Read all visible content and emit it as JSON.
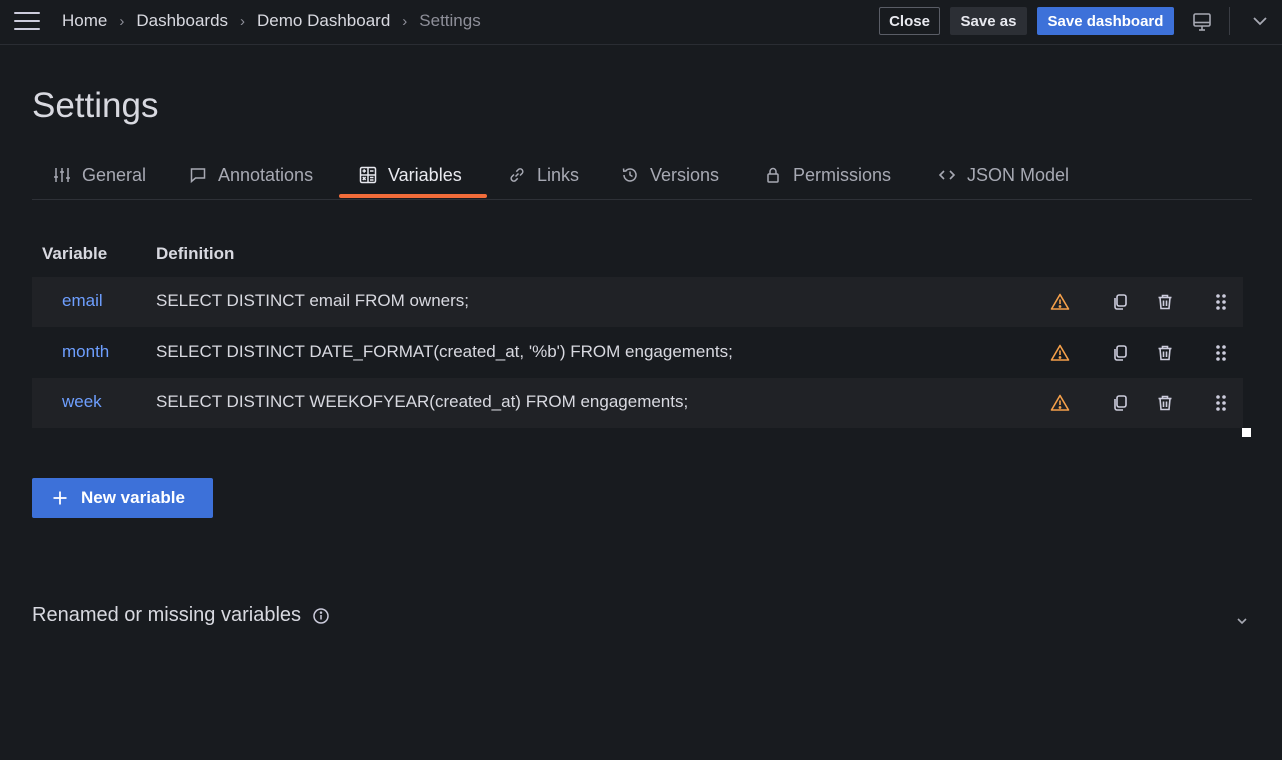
{
  "breadcrumb": {
    "items": [
      "Home",
      "Dashboards",
      "Demo Dashboard",
      "Settings"
    ]
  },
  "toolbar": {
    "close_label": "Close",
    "save_as_label": "Save as",
    "save_dashboard_label": "Save dashboard"
  },
  "page": {
    "title": "Settings"
  },
  "tabs": [
    {
      "label": "General",
      "icon": "sliders-icon"
    },
    {
      "label": "Annotations",
      "icon": "comment-icon"
    },
    {
      "label": "Variables",
      "icon": "calculator-icon",
      "active": true
    },
    {
      "label": "Links",
      "icon": "link-icon"
    },
    {
      "label": "Versions",
      "icon": "history-icon"
    },
    {
      "label": "Permissions",
      "icon": "lock-icon"
    },
    {
      "label": "JSON Model",
      "icon": "code-icon"
    }
  ],
  "table": {
    "headers": {
      "variable": "Variable",
      "definition": "Definition"
    },
    "rows": [
      {
        "name": "email",
        "definition": "SELECT DISTINCT email FROM owners;"
      },
      {
        "name": "month",
        "definition": "SELECT DISTINCT DATE_FORMAT(created_at, '%b') FROM engagements;"
      },
      {
        "name": "week",
        "definition": "SELECT DISTINCT WEEKOFYEAR(created_at) FROM engagements;"
      }
    ]
  },
  "actions": {
    "new_variable_label": "New variable"
  },
  "section": {
    "renamed_title": "Renamed or missing variables"
  },
  "colors": {
    "accent": "#3d71d9",
    "tab_underline": "#f16c3a",
    "warning": "#f5a04a",
    "link": "#6e9fff"
  }
}
